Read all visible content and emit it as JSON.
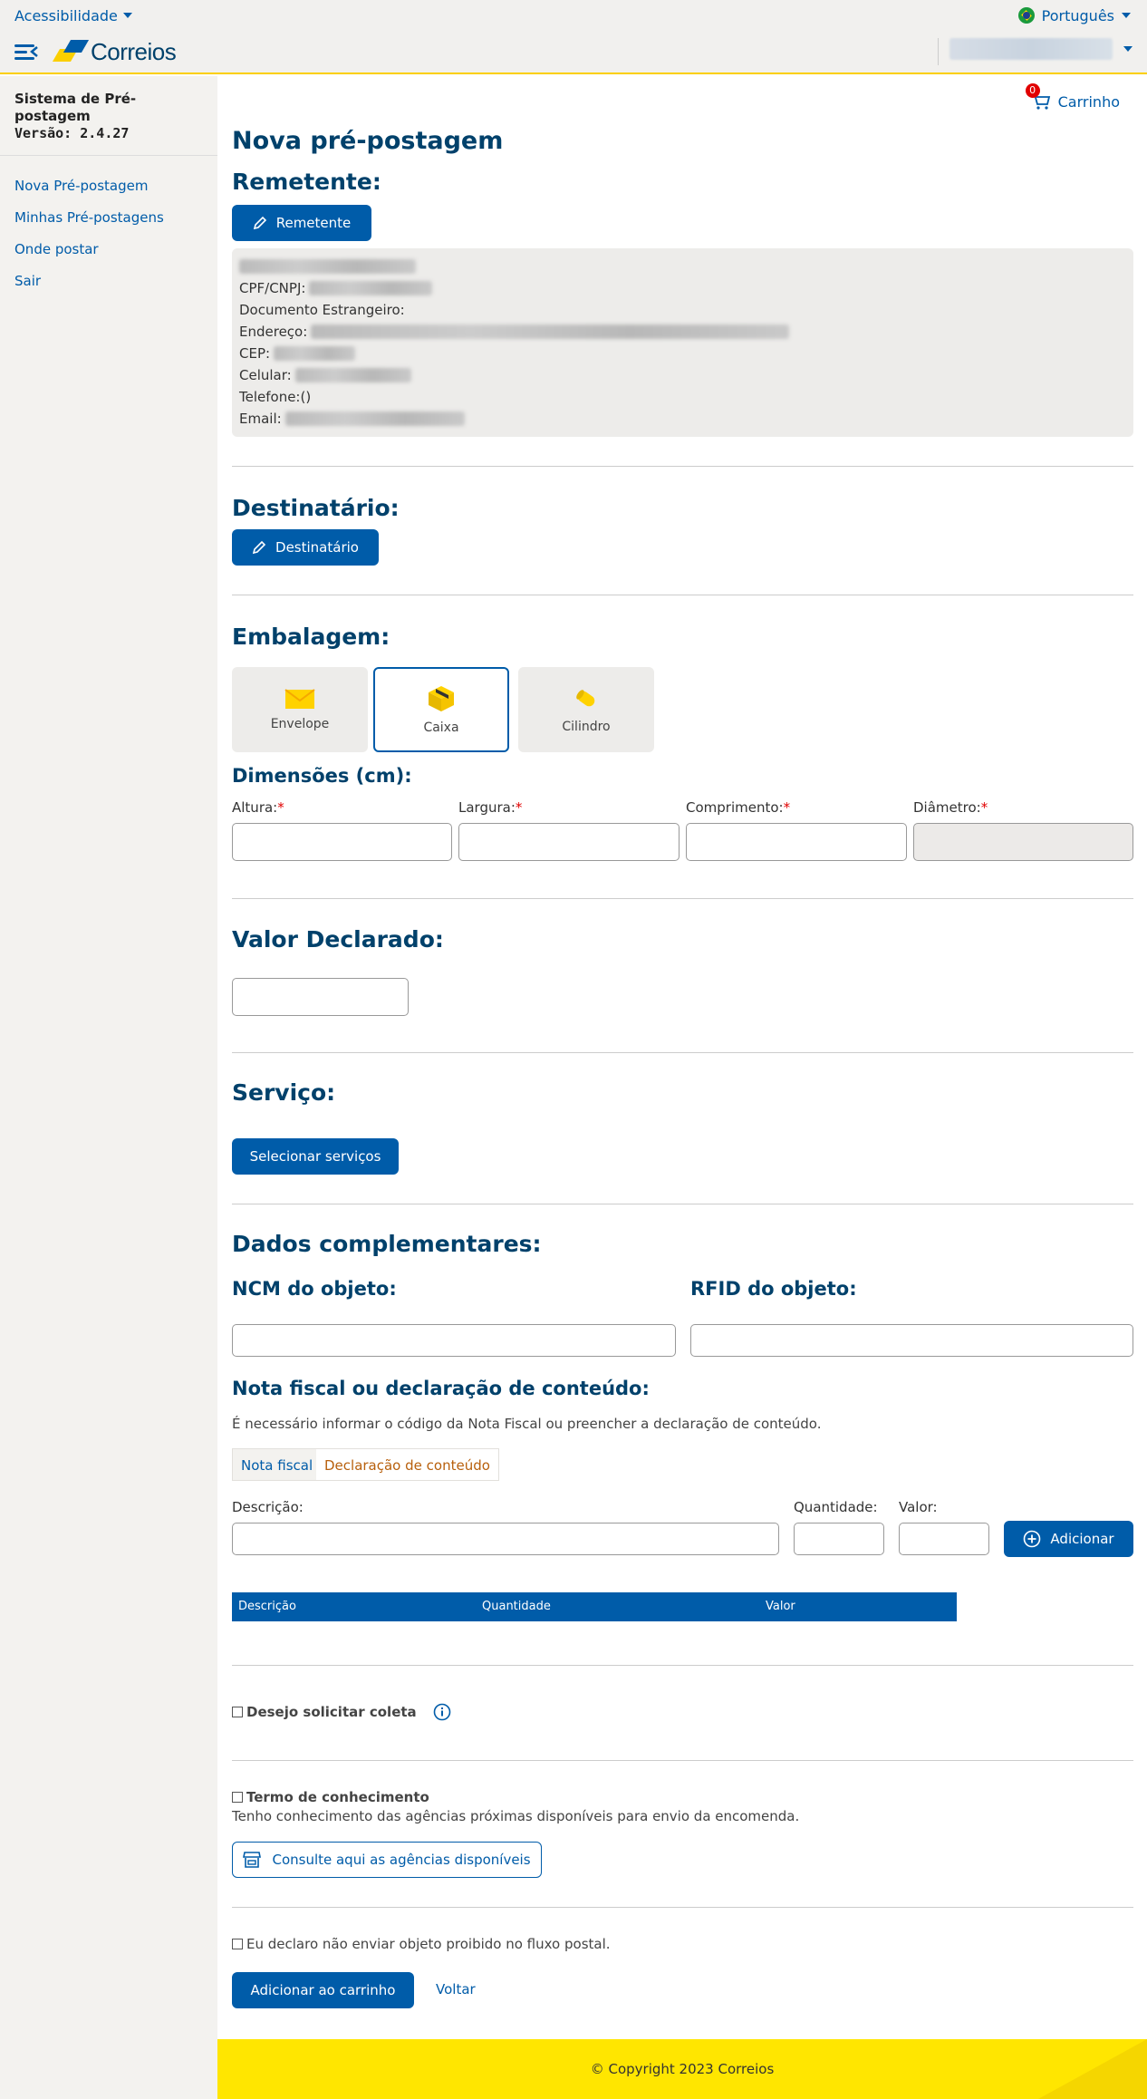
{
  "topbar": {
    "accessibility": "Acessibilidade",
    "language": "Português"
  },
  "header": {
    "logo": "Correios"
  },
  "sidebar": {
    "system_title": "Sistema de Pré-postagem",
    "version_label": "Versão: 2.4.27",
    "items": [
      "Nova Pré-postagem",
      "Minhas Pré-postagens",
      "Onde postar",
      "Sair"
    ]
  },
  "cart": {
    "label": "Carrinho",
    "count": "0"
  },
  "page": {
    "title": "Nova pré-postagem"
  },
  "remetente": {
    "heading": "Remetente:",
    "button": "Remetente",
    "fields": {
      "cpf": "CPF/CNPJ:",
      "doc": "Documento Estrangeiro:",
      "endereco": "Endereço:",
      "cep": "CEP:",
      "celular": "Celular:",
      "telefone": "Telefone:()",
      "email": "Email:"
    }
  },
  "destinatario": {
    "heading": "Destinatário:",
    "button": "Destinatário"
  },
  "embalagem": {
    "heading": "Embalagem:",
    "options": [
      "Envelope",
      "Caixa",
      "Cilindro"
    ],
    "selected": "Caixa"
  },
  "dimensoes": {
    "heading": "Dimensões (cm):",
    "altura": "Altura:",
    "largura": "Largura:",
    "comprimento": "Comprimento:",
    "diametro": "Diâmetro:",
    "required_mark": "*"
  },
  "valor": {
    "heading": "Valor Declarado:"
  },
  "servico": {
    "heading": "Serviço:",
    "button": "Selecionar serviços"
  },
  "dados": {
    "heading": "Dados complementares:",
    "ncm": "NCM do objeto:",
    "rfid": "RFID do objeto:",
    "nota_heading": "Nota fiscal ou declaração de conteúdo:",
    "nota_help": "É necessário informar o código da Nota Fiscal ou preencher a declaração de conteúdo.",
    "tabs": [
      "Nota fiscal",
      "Declaração de conteúdo"
    ],
    "descricao": "Descrição:",
    "quantidade": "Quantidade:",
    "valor": "Valor:",
    "add_button": "Adicionar",
    "table_headers": [
      "Descrição",
      "Quantidade",
      "Valor"
    ]
  },
  "coleta": {
    "label": "Desejo solicitar coleta"
  },
  "termo": {
    "label": "Termo de conhecimento",
    "text": "Tenho conhecimento das agências próximas disponíveis para envio da encomenda.",
    "button": "Consulte aqui as agências disponíveis"
  },
  "declaro": {
    "label": "Eu declaro não enviar objeto proibido no fluxo postal."
  },
  "actions": {
    "add_cart": "Adicionar ao carrinho",
    "back": "Voltar"
  },
  "footer": {
    "copyright": "© Copyright 2023 Correios"
  },
  "colors": {
    "primary": "#005ca9",
    "heading": "#00416b",
    "accent": "#ffe600"
  }
}
